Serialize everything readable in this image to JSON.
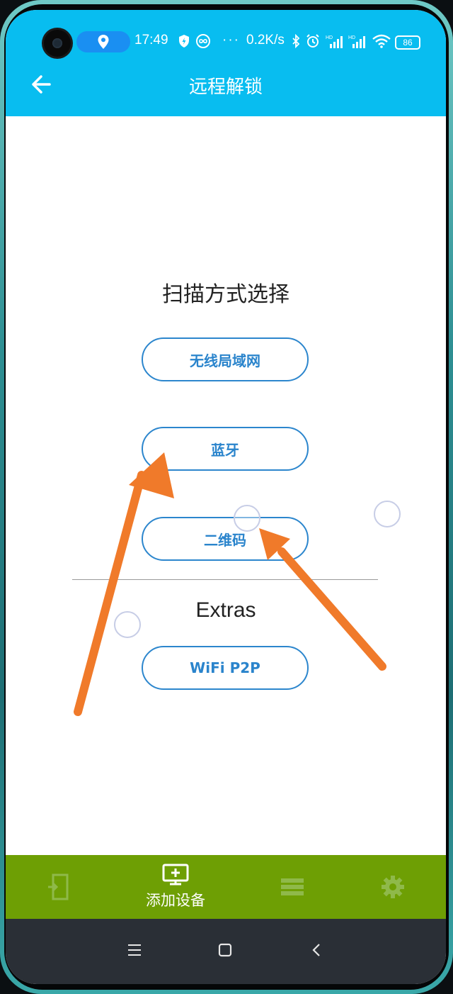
{
  "status_bar": {
    "time": "17:49",
    "speed": "0.2K/s",
    "dots": "···",
    "battery": "86",
    "icons": [
      "location-icon",
      "shield-icon",
      "bolt-icon",
      "infinity-icon",
      "bluetooth-icon",
      "alarm-icon",
      "signal-hd-icon",
      "signal-hd-icon",
      "wifi-icon",
      "battery-icon"
    ]
  },
  "header": {
    "title": "远程解锁",
    "back_icon": "arrow-left-icon",
    "background_color": "#08bdf0"
  },
  "scan": {
    "title": "扫描方式选择",
    "options": [
      {
        "label": "无线局域网"
      },
      {
        "label": "蓝牙"
      },
      {
        "label": "二维码"
      }
    ]
  },
  "extras": {
    "title": "Extras",
    "options": [
      {
        "label": "WiFi P2P"
      }
    ]
  },
  "bottom_nav": {
    "background_color": "#6e9f04",
    "items": [
      {
        "icon": "door-exit-icon",
        "label": "",
        "active": false
      },
      {
        "icon": "add-device-monitor-icon",
        "label": "添加设备",
        "active": true
      },
      {
        "icon": "list-icon",
        "label": "",
        "active": false
      },
      {
        "icon": "gear-icon",
        "label": "",
        "active": false
      }
    ]
  },
  "system_nav": {
    "icons": [
      "menu-icon",
      "home-square-icon",
      "back-chevron-icon"
    ]
  },
  "annotation": {
    "arrow_color": "#f07a2a"
  }
}
